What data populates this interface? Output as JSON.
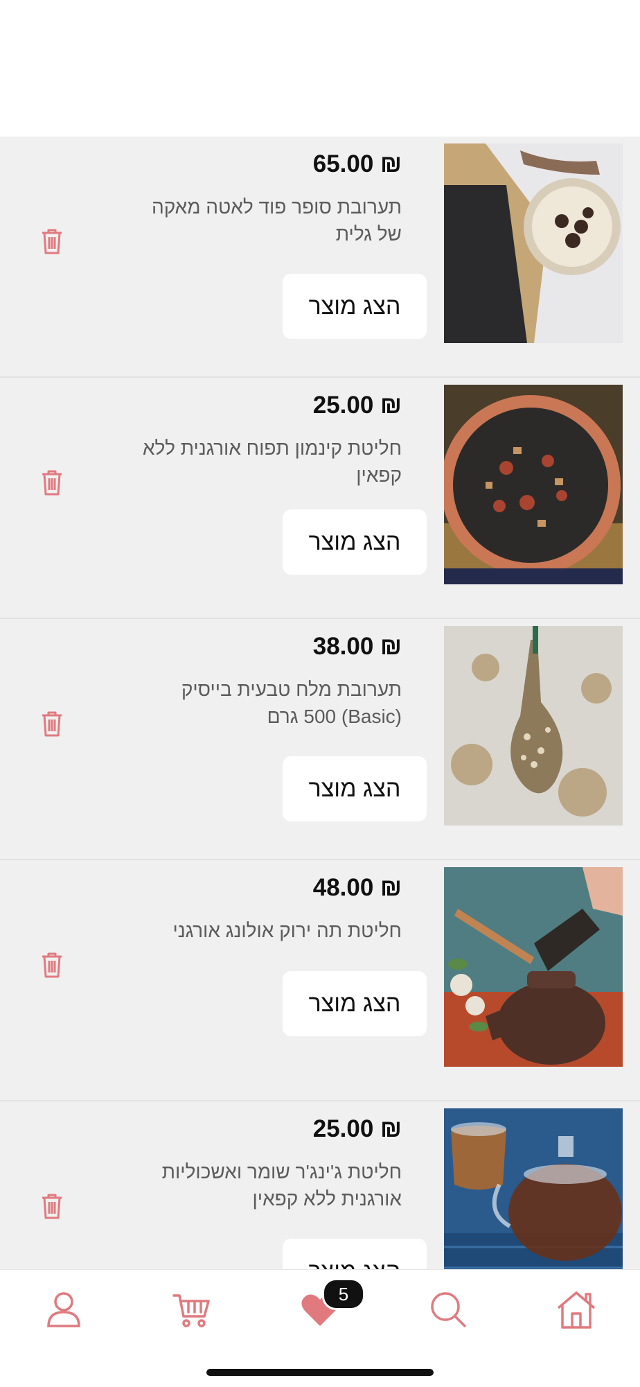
{
  "colors": {
    "accent": "#e07a7f",
    "page_bg": "#f1f0f1",
    "card_bg": "#f1f0f1"
  },
  "products": [
    {
      "price": "₪ 65.00",
      "title": "תערובת סופר פוד לאטה מאקה של גלית",
      "button": "הצג מוצר",
      "image": "latte-maca-product-photo"
    },
    {
      "price": "₪ 25.00",
      "title": "חליטת קינמון תפוח אורגנית ללא קפאין",
      "button": "הצג מוצר",
      "image": "cinnamon-apple-tea-photo"
    },
    {
      "price": "₪ 38.00",
      "title": "תערובת מלח טבעית בייסיק (Basic) 500 גרם",
      "button": "הצג מוצר",
      "image": "salt-blend-spoon-photo"
    },
    {
      "price": "₪ 48.00",
      "title": "חליטת תה ירוק אולונג אורגני",
      "button": "הצג מוצר",
      "image": "oolong-tea-pot-photo"
    },
    {
      "price": "₪ 25.00",
      "title": "חליטת ג'ינג'ר שומר ואשכוליות אורגנית ללא קפאין",
      "button": "הצג מוצר",
      "image": "ginger-fennel-tea-photo"
    }
  ],
  "nav": {
    "items": [
      "user-icon",
      "cart-icon",
      "heart-icon",
      "search-icon",
      "home-icon"
    ],
    "favorites_count": "5"
  }
}
